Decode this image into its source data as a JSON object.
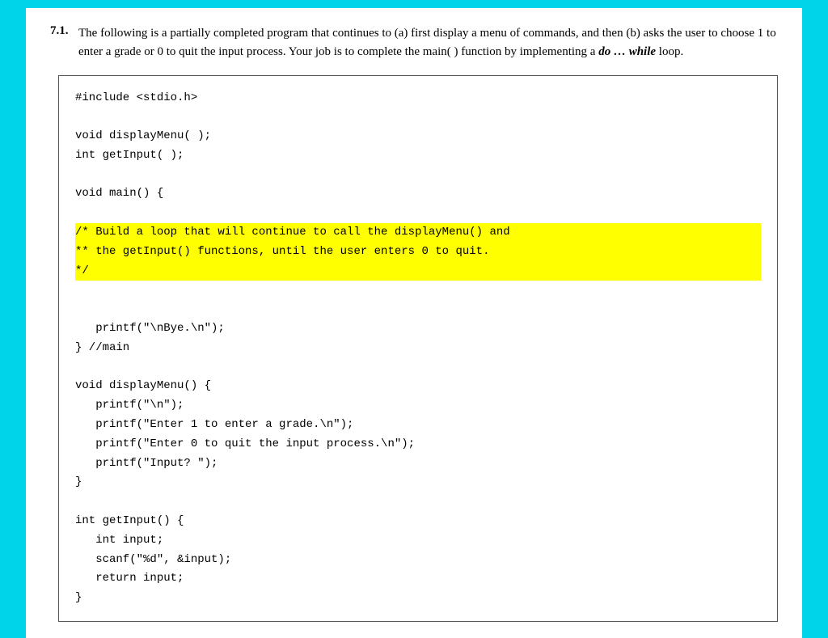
{
  "question": {
    "number": "7.1.",
    "text_part1": "The following is a partially completed program that continues to (a) first display a menu of commands, and then (b) asks the user to choose 1 to enter a grade or 0 to quit the input process. Your job is to complete the main( ) function by implementing a ",
    "bold_italic": "do … while",
    "text_part2": " loop.",
    "code": {
      "line1": "#include <stdio.h>",
      "line2": "",
      "line3": "void displayMenu( );",
      "line4": "int getInput( );",
      "line5": "",
      "line6": "void main() {",
      "line7": "",
      "line8_highlight": "/* Build a loop that will continue to call the displayMenu() and",
      "line9_highlight": "** the getInput() functions, until the user enters 0 to quit.",
      "line10_highlight": "*/",
      "line11": "",
      "line12": "",
      "line13": "   printf(\"\\nBye.\\n\");",
      "line14": "} //main",
      "line15": "",
      "line16": "void displayMenu() {",
      "line17": "   printf(\"\\n\");",
      "line18": "   printf(\"Enter 1 to enter a grade.\\n\");",
      "line19": "   printf(\"Enter 0 to quit the input process.\\n\");",
      "line20": "   printf(\"Input? \");",
      "line21": "}",
      "line22": "",
      "line23": "int getInput() {",
      "line24": "   int input;",
      "line25": "   scanf(\"%d\", &input);",
      "line26": "   return input;",
      "line27": "}"
    }
  }
}
